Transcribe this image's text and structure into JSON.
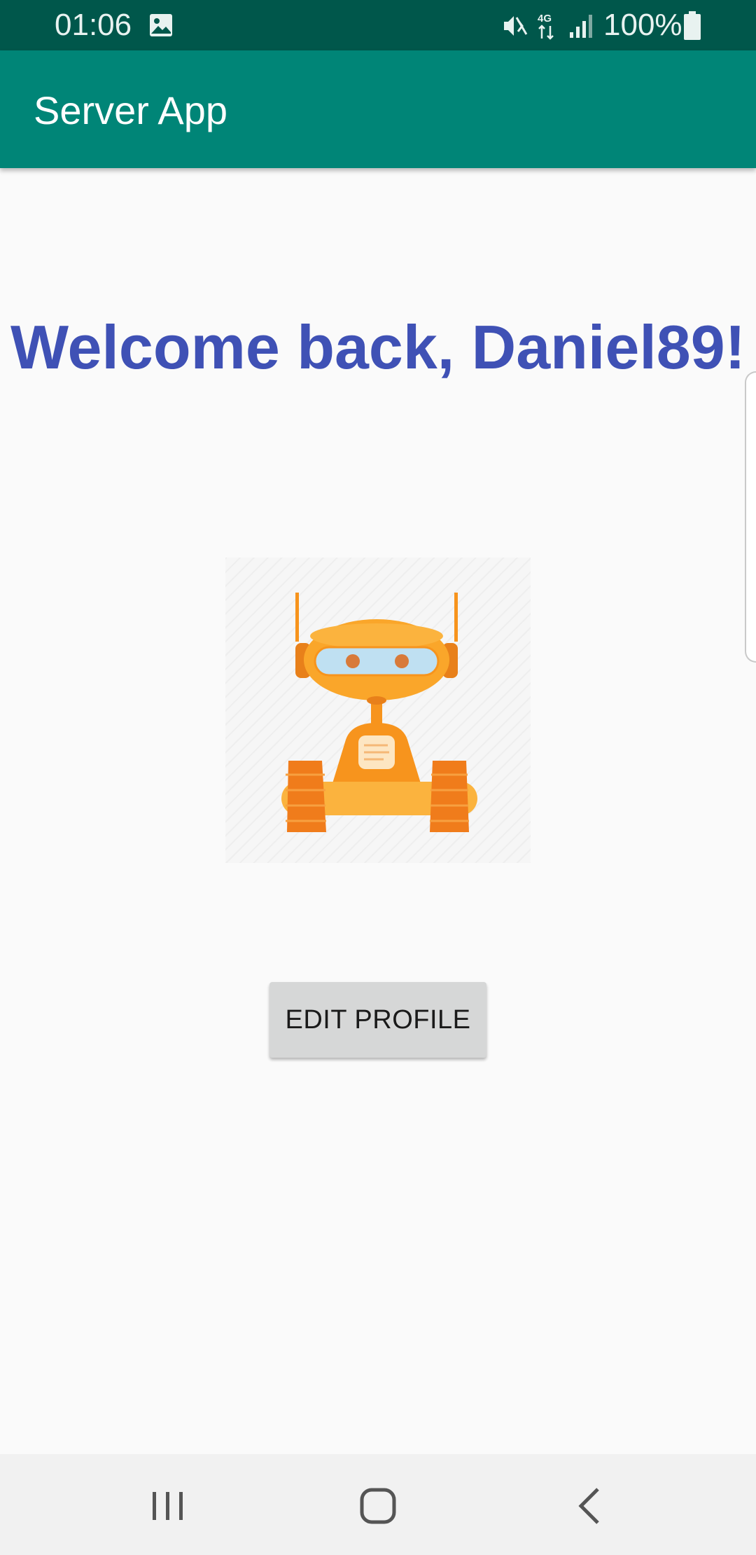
{
  "status_bar": {
    "time": "01:06",
    "battery": "100%",
    "network_label": "4G",
    "icons": [
      "image-icon",
      "mute-icon",
      "network-4g-icon",
      "signal-icon",
      "battery-icon"
    ]
  },
  "app_bar": {
    "title": "Server App"
  },
  "main": {
    "welcome_text": "Welcome back, Daniel89!",
    "avatar_icon": "robot-icon",
    "edit_button_label": "EDIT PROFILE"
  },
  "nav_bar": {
    "icons": [
      "recent-apps-icon",
      "home-icon",
      "back-icon"
    ]
  },
  "colors": {
    "status_bar": "#00574b",
    "app_bar": "#008577",
    "welcome_text": "#3f51b5",
    "button_bg": "#d6d7d7",
    "robot_orange": "#f7941d"
  }
}
